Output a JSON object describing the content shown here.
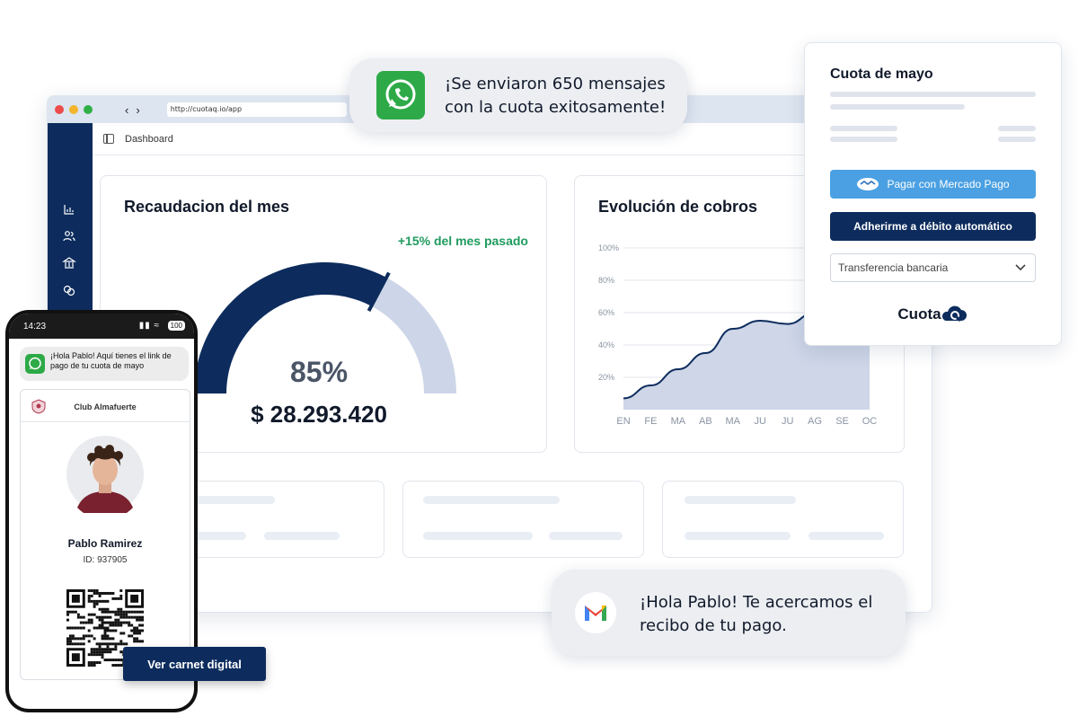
{
  "browser": {
    "url": "http://cuotaq.io/app",
    "breadcrumb": "Dashboard"
  },
  "recaudacion": {
    "title": "Recaudacion del mes",
    "growth": "+15% del mes pasado",
    "percent_label": "85%",
    "percent": 0.85,
    "amount": "$ 28.293.420"
  },
  "evolucion": {
    "title": "Evolución de cobros",
    "chart_data": {
      "type": "area",
      "title": "Evolución de cobros",
      "xlabel": "",
      "ylabel": "",
      "x": [
        "EN",
        "FE",
        "MA",
        "AB",
        "MA",
        "JU",
        "JU",
        "AG",
        "SE",
        "OC"
      ],
      "y_ticks": [
        "20%",
        "40%",
        "60%",
        "80%",
        "100%"
      ],
      "values": [
        7,
        15,
        25,
        35,
        50,
        55,
        53,
        60,
        75,
        88
      ],
      "ylim": [
        0,
        100
      ],
      "grid": true
    }
  },
  "whatsapp_toast": {
    "line1": "¡Se enviaron 650 mensajes",
    "line2": "con la cuota exitosamente!"
  },
  "gmail_toast": {
    "line1": "¡Hola Pablo! Te acercamos el",
    "line2": "recibo de tu pago."
  },
  "payment": {
    "title": "Cuota de mayo",
    "mercado_pago": "Pagar con Mercado Pago",
    "debito": "Adherirme a débito automático",
    "select_value": "Transferencia bancaria",
    "brand": "Cuota"
  },
  "phone": {
    "time": "14:23",
    "battery": "100",
    "notification": "¡Hola Pablo! Aquí tienes el link de pago de tu cuota de mayo",
    "club": "Club Almafuerte",
    "name": "Pablo Ramirez",
    "id": "ID: 937905",
    "button": "Ver carnet digital"
  },
  "colors": {
    "navy": "#0d2c5d",
    "gauge_bg": "#cdd6e8",
    "accent_green": "#1f9b5e",
    "mp_blue": "#4aa0e2"
  }
}
